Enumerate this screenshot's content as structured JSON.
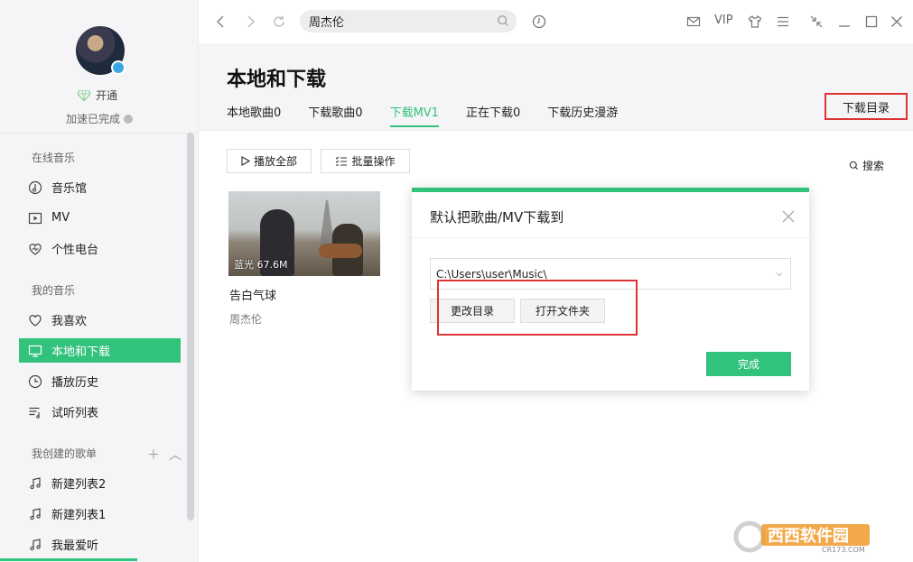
{
  "sidebar": {
    "vip_label": "开通",
    "accel_label": "加速已完成",
    "sections": {
      "online": "在线音乐",
      "mine": "我的音乐",
      "created": "我创建的歌单"
    },
    "online_items": [
      {
        "label": "音乐馆",
        "icon": "music-hall-icon"
      },
      {
        "label": "MV",
        "icon": "mv-icon"
      },
      {
        "label": "个性电台",
        "icon": "radio-icon"
      }
    ],
    "mine_items": [
      {
        "label": "我喜欢",
        "icon": "heart-icon"
      },
      {
        "label": "本地和下载",
        "icon": "computer-icon",
        "active": true
      },
      {
        "label": "播放历史",
        "icon": "clock-icon"
      },
      {
        "label": "试听列表",
        "icon": "list-icon"
      }
    ],
    "playlists": [
      {
        "label": "新建列表2"
      },
      {
        "label": "新建列表1"
      },
      {
        "label": "我最爱听"
      }
    ]
  },
  "topbar": {
    "search_value": "周杰伦",
    "vip_text": "VIP"
  },
  "header": {
    "title": "本地和下载",
    "tabs": [
      {
        "label": "本地歌曲0"
      },
      {
        "label": "下载歌曲0"
      },
      {
        "label": "下载MV1",
        "active": true
      },
      {
        "label": "正在下载0"
      },
      {
        "label": "下载历史漫游"
      }
    ],
    "download_dir_label": "下载目录"
  },
  "content": {
    "play_all_label": "播放全部",
    "batch_label": "批量操作",
    "search_label": "搜索",
    "mv": {
      "badge": "蓝光 67.6M",
      "title": "告白气球",
      "artist": "周杰伦"
    }
  },
  "dialog": {
    "title": "默认把歌曲/MV下载到",
    "path": "C:\\Users\\user\\Music\\",
    "change_dir_label": "更改目录",
    "open_folder_label": "打开文件夹",
    "done_label": "完成"
  },
  "watermark": {
    "text": "西西软件园",
    "sub": "CR173.COM"
  },
  "colors": {
    "accent": "#31c27c",
    "highlight": "#dd3333"
  }
}
